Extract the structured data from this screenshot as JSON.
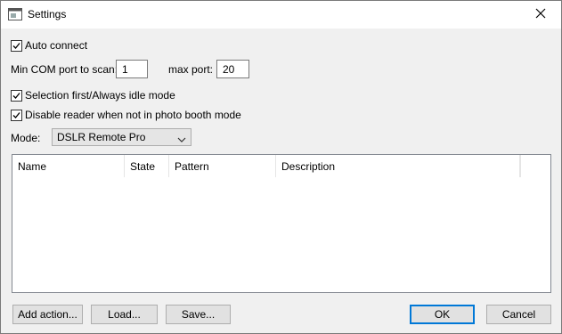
{
  "window": {
    "title": "Settings"
  },
  "options": {
    "auto_connect": {
      "label": "Auto connect",
      "checked": true
    },
    "min_com_label": "Min COM port to scan:",
    "min_com_value": "1",
    "max_port_label": "max port:",
    "max_port_value": "20",
    "selection_first": {
      "label": "Selection first/Always idle mode",
      "checked": true
    },
    "disable_reader": {
      "label": "Disable reader when not in photo booth mode",
      "checked": true
    },
    "mode_label": "Mode:",
    "mode_value": "DSLR Remote Pro"
  },
  "table": {
    "columns": [
      "Name",
      "State",
      "Pattern",
      "Description"
    ],
    "rows": []
  },
  "buttons": {
    "add_action": "Add action...",
    "load": "Load...",
    "save": "Save...",
    "ok": "OK",
    "cancel": "Cancel"
  },
  "icons": {
    "app": "settings-window-icon",
    "close": "close-icon",
    "check": "checkmark-icon",
    "dropdown": "chevron-down-icon"
  }
}
